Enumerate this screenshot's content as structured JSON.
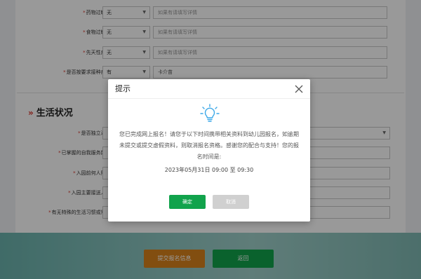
{
  "form": {
    "rows": [
      {
        "label": "药物过敏史:",
        "select": "无",
        "detail": "如果有请填写详情"
      },
      {
        "label": "食物过敏史:",
        "select": "无",
        "detail": "如果有请填写详情"
      },
      {
        "label": "先天性疾病:",
        "select": "无",
        "detail": "如果有请填写详情"
      },
      {
        "label": "是否按要求接种疫苗:",
        "select": "有",
        "detail": "卡介苗"
      }
    ],
    "life_section_title": "生活状况",
    "life_rows": [
      {
        "label": "是否独立进餐:"
      },
      {
        "label": "已掌握的自我服务能力:"
      },
      {
        "label": "入园前何人照顾:"
      },
      {
        "label": "入园主要接送人员:"
      },
      {
        "label": "有无特殊的生活习惯或需求:"
      }
    ],
    "required_mark": "*"
  },
  "footer": {
    "submit_label": "提交报名信息",
    "back_label": "返回"
  },
  "modal": {
    "title": "提示",
    "message": "您已完成网上报名！请您于以下时间携带相关资料到幼儿园报名，如逾期未提交或提交虚假资料，则取消报名资格。感谢您的配合与支持！您的报名时间是:",
    "time_text": "2023年05月31日 09:00 至 09:30",
    "ok_label": "确定",
    "cancel_label": "取消"
  },
  "colors": {
    "primary_green": "#11a34c",
    "submit_orange": "#d9831c",
    "required_red": "#d9352b",
    "bulb_blue": "#3da9e8"
  }
}
